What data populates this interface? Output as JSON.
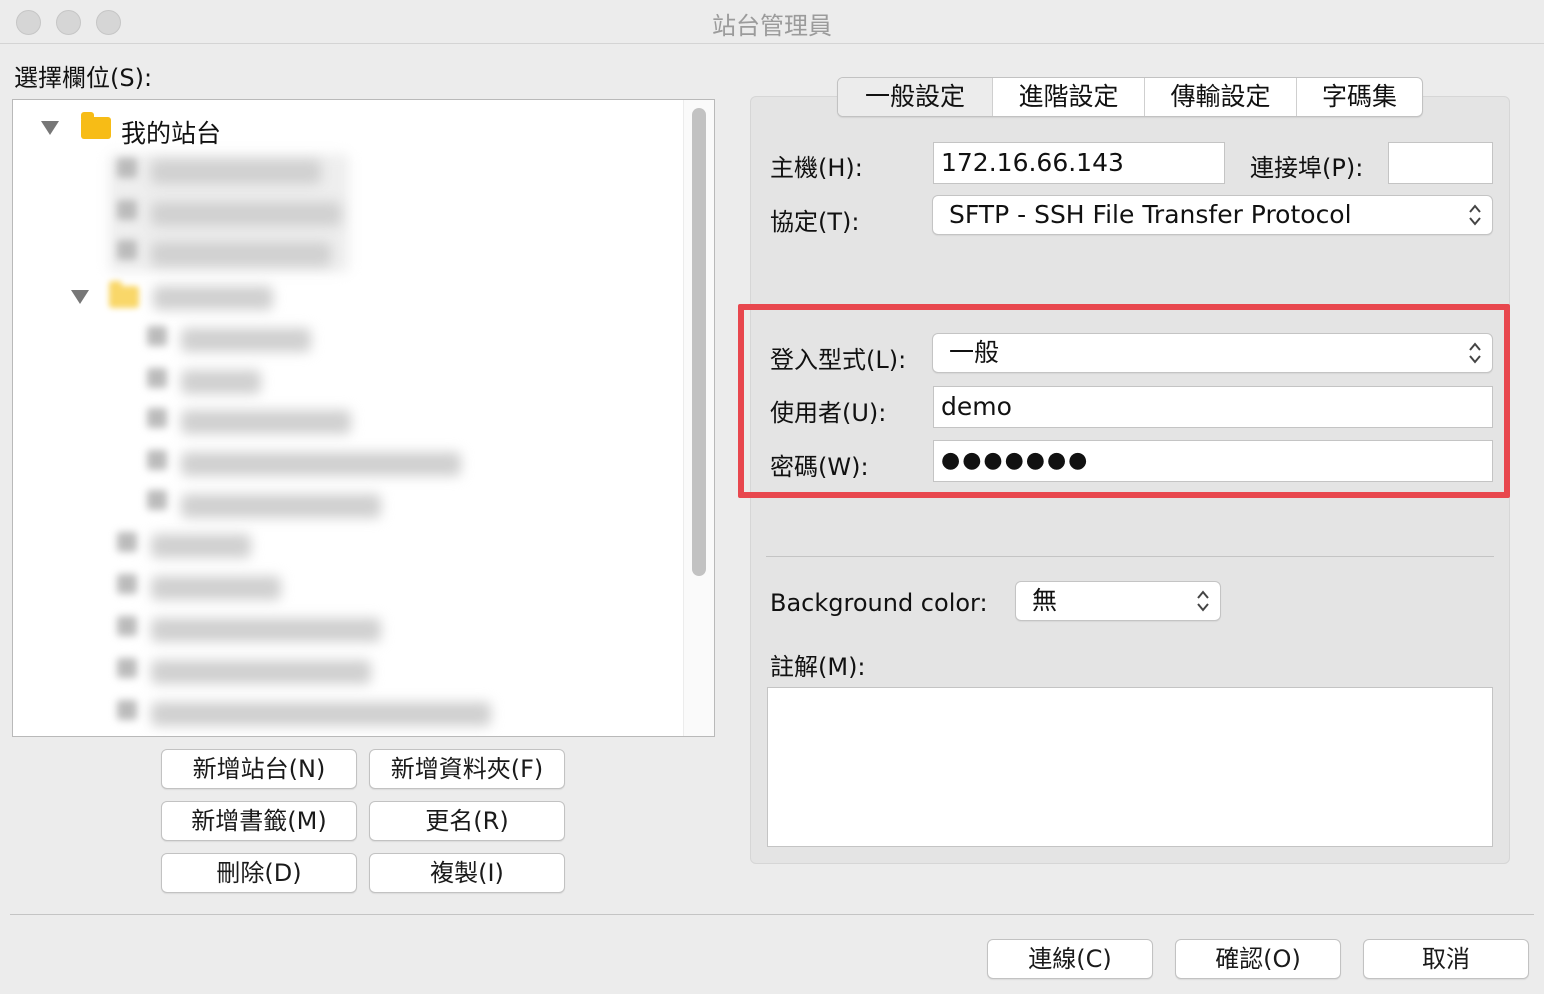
{
  "window": {
    "title": "站台管理員"
  },
  "left": {
    "select_label": "選擇欄位(S):",
    "tree_root": "我的站台",
    "buttons": {
      "new_site": "新增站台(N)",
      "new_folder": "新增資料夾(F)",
      "new_bookmark": "新增書籤(M)",
      "rename": "更名(R)",
      "delete": "刪除(D)",
      "copy": "複製(I)"
    }
  },
  "tabs": [
    {
      "label": "一般設定",
      "active": true
    },
    {
      "label": "進階設定",
      "active": false
    },
    {
      "label": "傳輸設定",
      "active": false
    },
    {
      "label": "字碼集",
      "active": false
    }
  ],
  "general": {
    "host_label": "主機(H):",
    "host_value": "172.16.66.143",
    "port_label": "連接埠(P):",
    "port_value": "",
    "protocol_label": "協定(T):",
    "protocol_value": "SFTP - SSH File Transfer Protocol",
    "logon_type_label": "登入型式(L):",
    "logon_type_value": "一般",
    "user_label": "使用者(U):",
    "user_value": "demo",
    "password_label": "密碼(W):",
    "password_value": "●●●●●●●",
    "bgcolor_label": "Background color:",
    "bgcolor_value": "無",
    "comments_label": "註解(M):",
    "comments_value": ""
  },
  "footer": {
    "connect": "連線(C)",
    "ok": "確認(O)",
    "cancel": "取消"
  },
  "colors": {
    "highlight": "#e8474e",
    "folder": "#f7bc16"
  }
}
